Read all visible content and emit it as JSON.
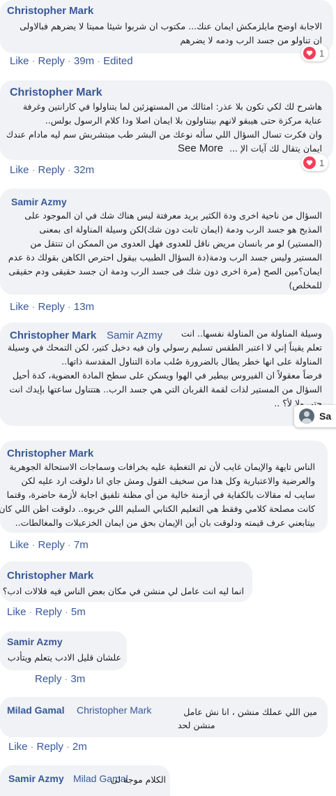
{
  "comments": [
    {
      "name": "Christopher Mark",
      "lines": [
        "الاجابة اوضح مايلزمكش ايمان عنك... مكتوب ان شربوا شيئا مميتا لا يضرهم فبالاولى",
        "ان تناولو من جسد الرب ودمه لا يضرهم"
      ],
      "like": "Like",
      "reply": "Reply",
      "time": "39m",
      "edited": "Edited",
      "reactions": "1"
    },
    {
      "name": "Christopher Mark",
      "lines": [
        "هاشرح لك لكي تكون بلا عذر: امثالك من المستهزئين لما يتناولوا في كارانتين وغرفة",
        "عناية مركزة حتى هيبقو لانهم بيتناولون بلا ايمان اصلا ودا كلام الرسول بولس..",
        "وان فكرت تسال السؤال اللي سأله نوعك من البشر طب مبتشربش سم ليه مادام عندك",
        "ايمان يتقال لك آيات الإ ..."
      ],
      "see_more": "See More",
      "like": "Like",
      "reply": "Reply",
      "time": "32m",
      "reactions": "1"
    },
    {
      "name": "Samir Azmy",
      "lines": [
        "السؤال من ناحية اخرى ودة الكثير يريد معرفتة ليس هناك شك في ان الموجود على",
        "المذبح هو جسد الرب ودمة (ايمان ثابت دون شك)لكن وسيلة المناولة اى بمعنى",
        "(المستير) لو مر بانسان مريض ناقل للعدوى فهل العدوى من الممكن ان تنتقل من",
        "المستير وليس جسد الرب ودمة(دة السؤال الطبيب بيقول احترص الكاهن بقولك دة عدم",
        "ايمان؟مين الصح (مرة اخرى دون شك فى جسد الرب ودمة ان جسد حقيقى ودم حقيقى",
        "للمخلص)"
      ],
      "like": "Like",
      "reply": "Reply",
      "time": "13m"
    },
    {
      "name": "Christopher Mark",
      "mention": "Samir Azmy",
      "lines": [
        "وسيلة المناولة من المناولة نفسها.. انت",
        "تعلم يقيناً إني لا اعتبر الطقس تسليم رسولي وان فيه دخيل كتير، لكن التمحك في وسيلة",
        "المناولة على انها خطر يطال بالضرورة صُلب مادة التناول المقدسة ذاتها..",
        "فرضاً معقولاً ان الفيروس بيطير في الهوا ويسكن على سطح المادة العضوية، كدة أحيل",
        "السؤال من المستير لذات لقمة القربان التي هي جسد الرب.. هتتناول ساعتها بإيدك انت",
        "حتى ولا لأ؟ .."
      ]
    },
    {
      "name": "Christopher Mark",
      "lines": [
        "الناس تايهة والإيمان غايب لأن تم التغطية عليه بخرافات وسماجات الاستحالة الجوهرية",
        "والعرضية والاعتبارية وكل هذا من سخيف القول ومش جاي انا دلوقت ارد عليه لكن",
        "سايب له مقالات بالكفاية في أزمنة خالية من أي مظنة تلفيق اجابة لأزمة حاضرة، وقتما",
        "كانت مصلحة كلامي وفقط هي التعليم الكتابي السليم اللي خربوه.. دلوقت اظن اللي كان",
        "بيتابعني عرف قيمته ودلوقت بان أين الإيمان بحق من ايمان الخزعبلات والمغالطات.."
      ],
      "like": "Like",
      "reply": "Reply",
      "time": "7m"
    },
    {
      "name": "Christopher Mark",
      "lines": [
        "انما ليه انت عامل لي منشن في مكان بعض الناس فيه قلالات ادب؟"
      ],
      "like": "Like",
      "reply": "Reply",
      "time": "5m"
    },
    {
      "name": "Samir Azmy",
      "lines": [
        "علشان قليل الادب يتعلم ويتأدب"
      ],
      "reply": "Reply",
      "time": "3m"
    },
    {
      "name": "Milad Gamal",
      "mention": "Christopher Mark",
      "lines": [
        "مين اللي عملك منشن ، انا نش عامل",
        "منشن لحد"
      ],
      "like": "Like",
      "reply": "Reply",
      "time": "2m"
    },
    {
      "name": "Samir Azmy",
      "mention": "Milad Gamal",
      "lines": [
        "الكلام موجة لى"
      ]
    }
  ],
  "popup_label": "Sa",
  "colors": {
    "link": "#385898",
    "bubble": "#f0f2f5",
    "heart": "#f33e58"
  }
}
